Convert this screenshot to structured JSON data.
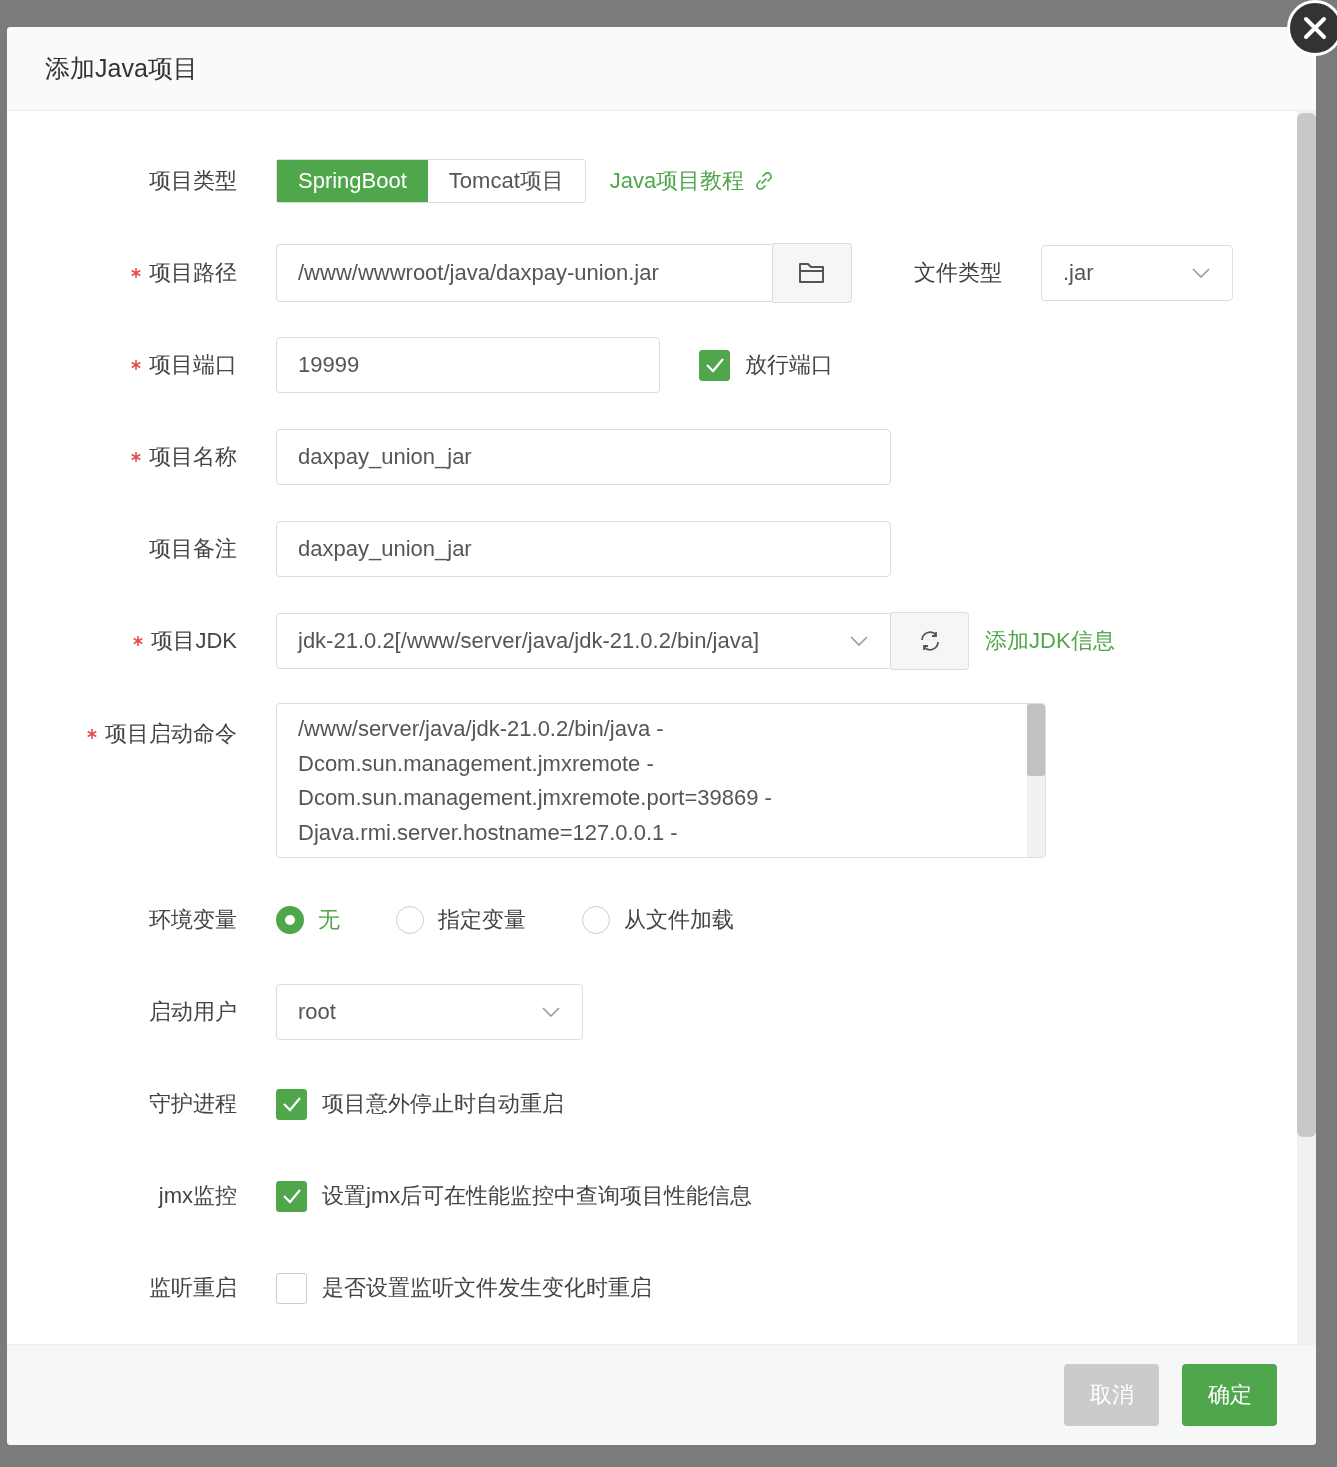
{
  "dialog": {
    "title": "添加Java项目"
  },
  "fields": [
    {
      "kind": "project_type",
      "label": "项目类型",
      "required": false,
      "options": [
        {
          "label": "SpringBoot",
          "selected": true
        },
        {
          "label": "Tomcat项目",
          "selected": false
        }
      ],
      "link": "Java项目教程"
    },
    {
      "kind": "path",
      "label": "项目路径",
      "required": true,
      "value": "/www/wwwroot/java/daxpay-union.jar",
      "side_label": "文件类型",
      "side_value": ".jar"
    },
    {
      "kind": "port",
      "label": "项目端口",
      "required": true,
      "value": "19999",
      "option": {
        "label": "放行端口",
        "checked": true
      }
    },
    {
      "kind": "text",
      "label": "项目名称",
      "required": true,
      "value": "daxpay_union_jar"
    },
    {
      "kind": "text",
      "label": "项目备注",
      "required": false,
      "value": "daxpay_union_jar"
    },
    {
      "kind": "jdk",
      "label": "项目JDK",
      "required": true,
      "value": "jdk-21.0.2[/www/server/java/jdk-21.0.2/bin/java]",
      "link": "添加JDK信息"
    },
    {
      "kind": "command",
      "label": "项目启动命令",
      "required": true,
      "lines": [
        "/www/server/java/jdk-21.0.2/bin/java -",
        "Dcom.sun.management.jmxremote -",
        "Dcom.sun.management.jmxremote.port=39869 -",
        "Djava.rmi.server.hostname=127.0.0.1 -"
      ]
    },
    {
      "kind": "radio",
      "label": "环境变量",
      "required": false,
      "options": [
        {
          "label": "无",
          "selected": true
        },
        {
          "label": "指定变量",
          "selected": false
        },
        {
          "label": "从文件加载",
          "selected": false
        }
      ]
    },
    {
      "kind": "select",
      "label": "启动用户",
      "required": false,
      "value": "root"
    },
    {
      "kind": "checkbox",
      "label": "守护进程",
      "required": false,
      "option": {
        "label": "项目意外停止时自动重启",
        "checked": true
      }
    },
    {
      "kind": "checkbox",
      "label": "jmx监控",
      "required": false,
      "option": {
        "label": "设置jmx后可在性能监控中查询项目性能信息",
        "checked": true
      }
    },
    {
      "kind": "checkbox",
      "label": "监听重启",
      "required": false,
      "option": {
        "label": "是否设置监听文件发生变化时重启",
        "checked": false
      }
    }
  ],
  "buttons": [
    {
      "label": "取消",
      "kind": "cancel"
    },
    {
      "label": "确定",
      "kind": "primary"
    }
  ]
}
